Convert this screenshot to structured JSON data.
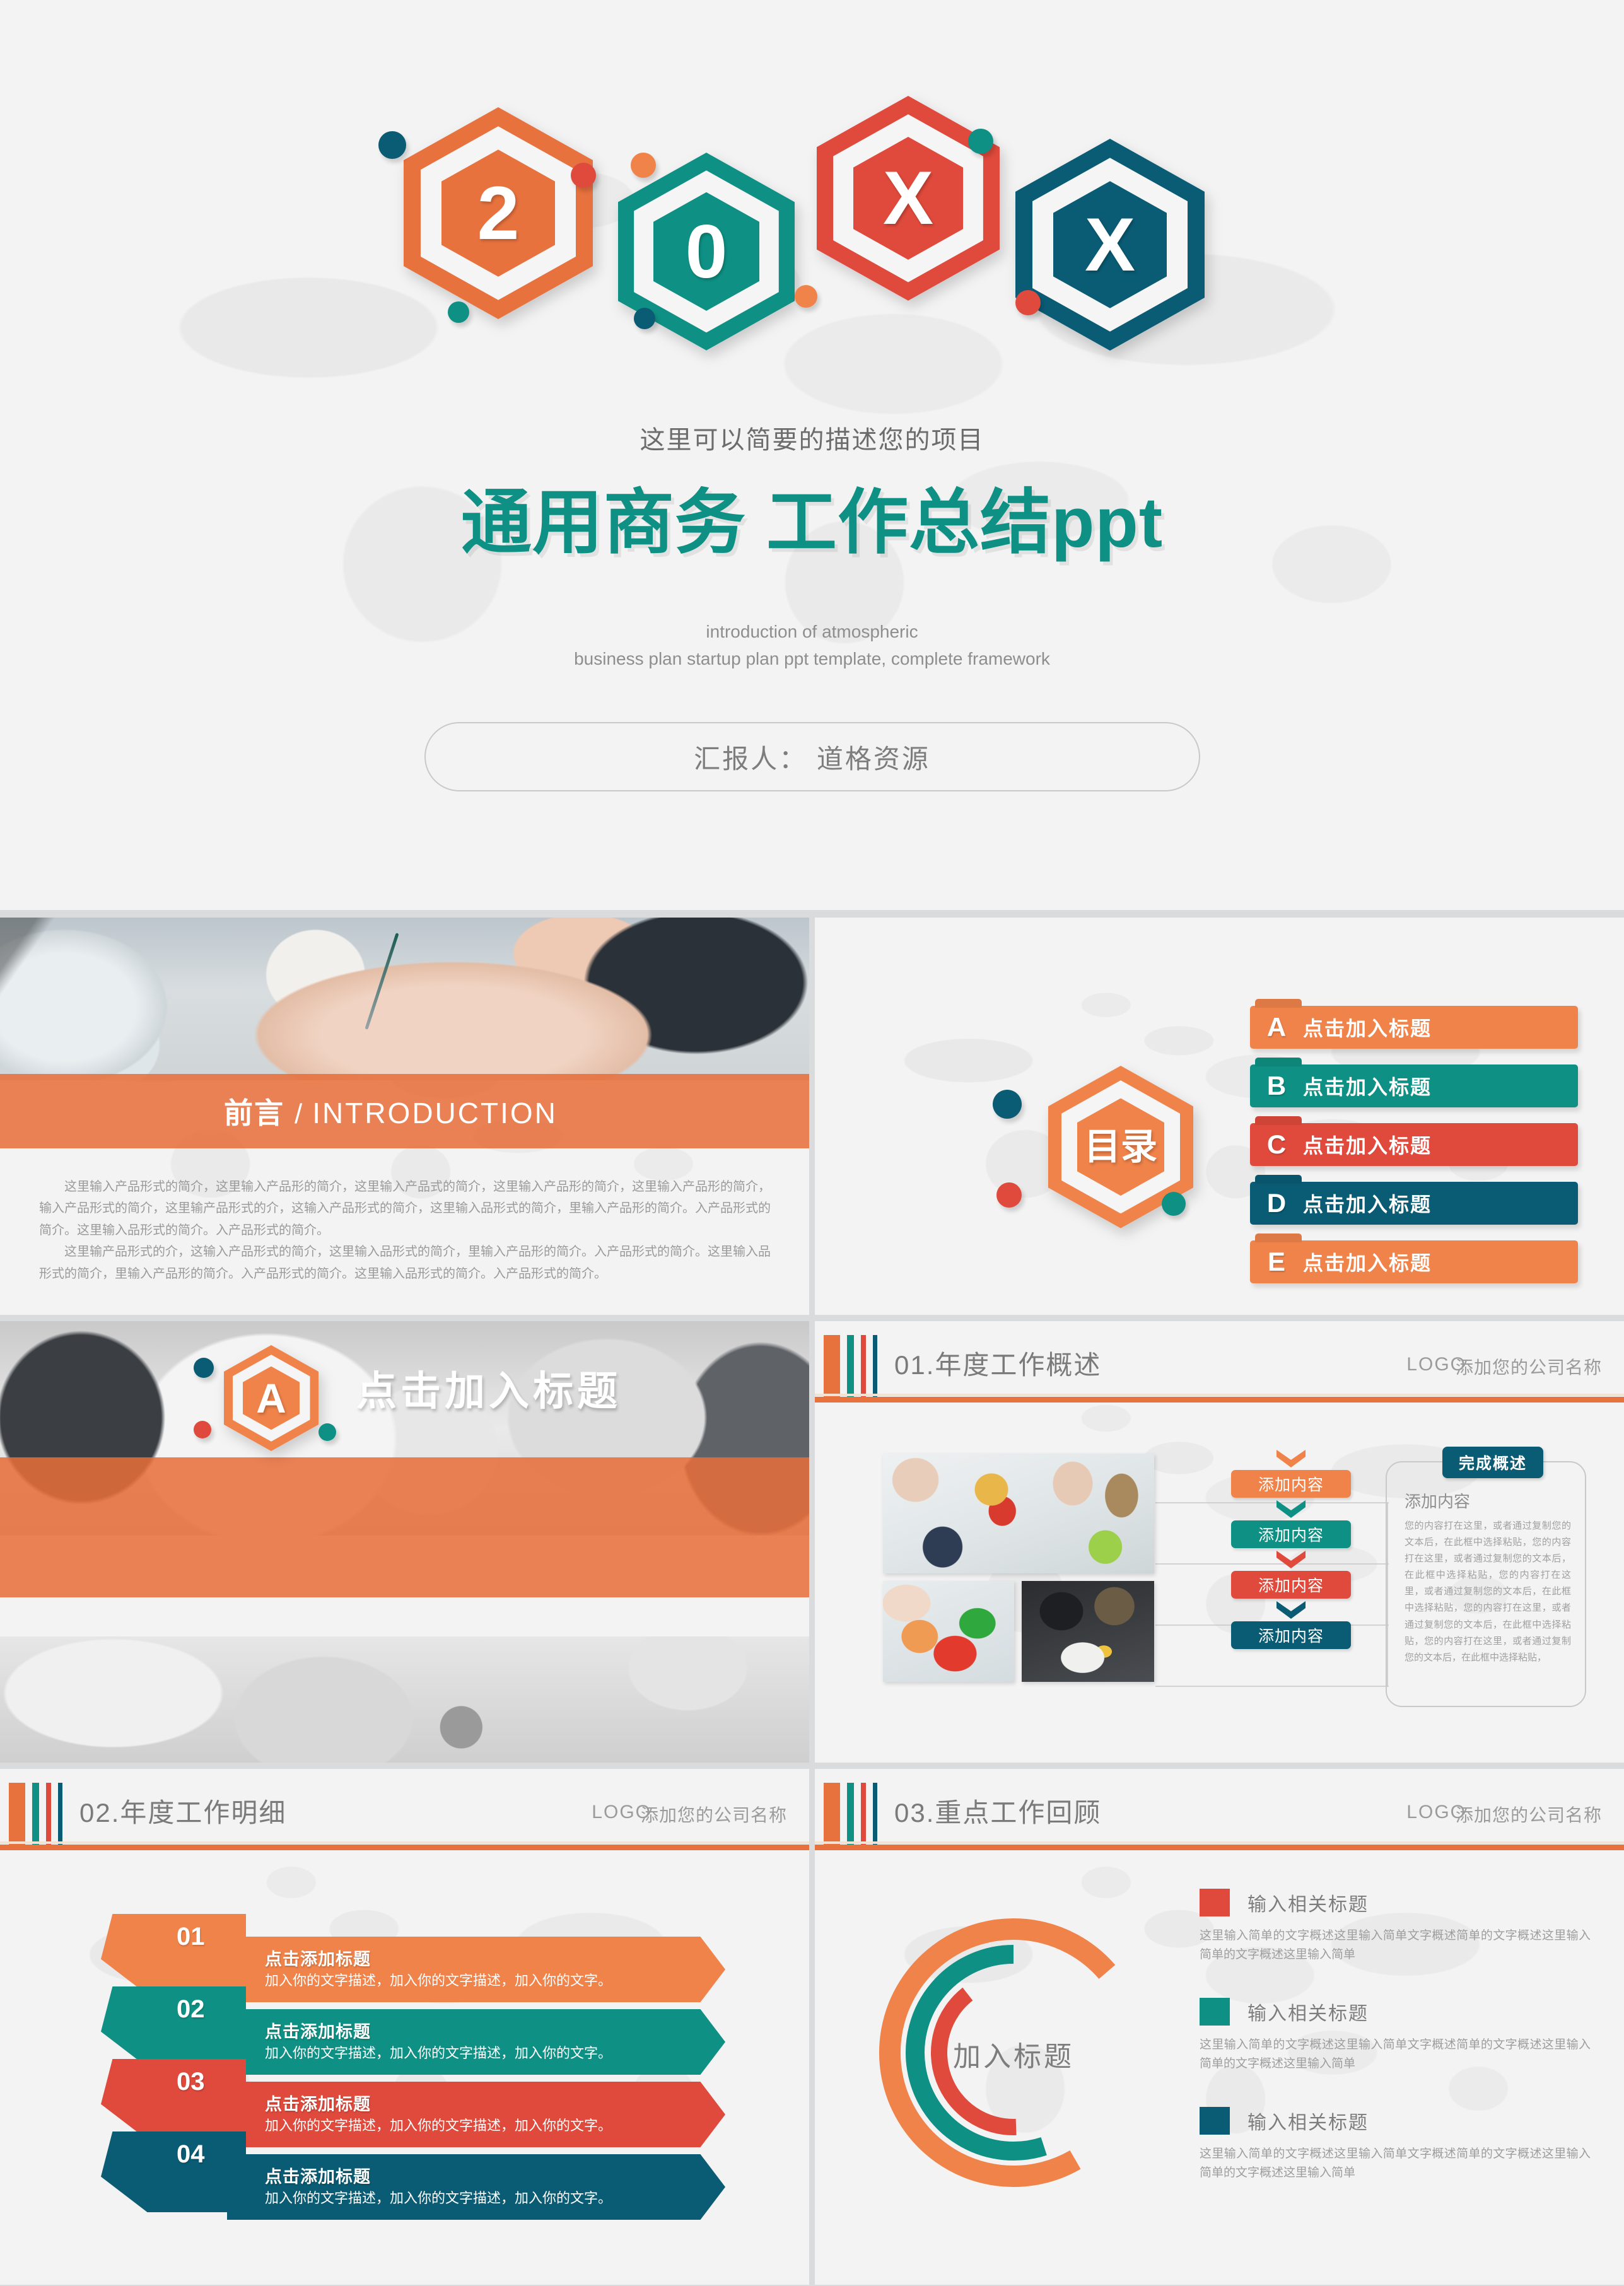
{
  "colors": {
    "orange": "#e8723e",
    "orange_light": "#f0834a",
    "teal": "#0e9184",
    "red": "#e04a3c",
    "navy": "#0a5c74",
    "bg": "#f3f3f3",
    "text_grey": "#7d7d7d"
  },
  "cover": {
    "hexagons": [
      {
        "glyph": "2",
        "color": "#e8723e"
      },
      {
        "glyph": "0",
        "color": "#0e9184"
      },
      {
        "glyph": "X",
        "color": "#e04a3c"
      },
      {
        "glyph": "X",
        "color": "#0a5c74"
      }
    ],
    "subtitle": "这里可以简要的描述您的项目",
    "title": "通用商务 工作总结ppt",
    "en_line1": "introduction of atmospheric",
    "en_line2": "business plan startup plan ppt template, complete framework",
    "presenter": "汇报人： 道格资源"
  },
  "intro": {
    "band_cn": "前言",
    "band_slash": "/",
    "band_en": "INTRODUCTION",
    "paragraph1": "这里输入产品形式的简介，这里输入产品形的简介，这里输入产品式的简介，这里输入产品形的简介，这里输入产品形的简介，输入产品形式的简介，这里输产品形式的介，这输入产品形式的简介，这里输入品形式的简介，里输入产品形的简介。入产品形式的简介。这里输入品形式的简介。入产品形式的简介。",
    "paragraph2": "这里输产品形式的介，这输入产品形式的简介，这里输入品形式的简介，里输入产品形的简介。入产品形式的简介。这里输入品形式的简介，里输入产品形的简介。入产品形式的简介。这里输入品形式的简介。入产品形式的简介。"
  },
  "toc": {
    "hex_label": "目录",
    "items": [
      {
        "letter": "A",
        "label": "点击加入标题",
        "color": "#f0834a"
      },
      {
        "letter": "B",
        "label": "点击加入标题",
        "color": "#0e9184"
      },
      {
        "letter": "C",
        "label": "点击加入标题",
        "color": "#e04a3c"
      },
      {
        "letter": "D",
        "label": "点击加入标题",
        "color": "#0a5c74"
      },
      {
        "letter": "E",
        "label": "点击加入标题",
        "color": "#f0834a"
      }
    ]
  },
  "section": {
    "hex_letter": "A",
    "title": "点击加入标题"
  },
  "overview": {
    "header_title": "01.年度工作概述",
    "logo": "LOGO",
    "company": "添加您的公司名称",
    "flow": [
      {
        "label": "添加内容",
        "color": "#f0834a"
      },
      {
        "label": "添加内容",
        "color": "#0e9184"
      },
      {
        "label": "添加内容",
        "color": "#e04a3c"
      },
      {
        "label": "添加内容",
        "color": "#0a5c74"
      }
    ],
    "card_tab": "完成概述",
    "card_heading": "添加内容",
    "card_body": "您的内容打在这里，或者通过复制您的文本后，在此框中选择粘贴，您的内容打在这里，或者通过复制您的文本后，在此框中选择粘贴，您的内容打在这里，或者通过复制您的文本后，在此框中选择粘贴，您的内容打在这里，或者通过复制您的文本后，在此框中选择粘贴，您的内容打在这里，或者通过复制您的文本后，在此框中选择粘贴，"
  },
  "detail": {
    "header_title": "02.年度工作明细",
    "logo": "LOGO",
    "company": "添加您的公司名称",
    "rows": [
      {
        "num": "01",
        "title": "点击添加标题",
        "desc": "加入你的文字描述，加入你的文字描述，加入你的文字。",
        "color": "#f0834a"
      },
      {
        "num": "02",
        "title": "点击添加标题",
        "desc": "加入你的文字描述，加入你的文字描述，加入你的文字。",
        "color": "#0e9184"
      },
      {
        "num": "03",
        "title": "点击添加标题",
        "desc": "加入你的文字描述，加入你的文字描述，加入你的文字。",
        "color": "#e04a3c"
      },
      {
        "num": "04",
        "title": "点击添加标题",
        "desc": "加入你的文字描述，加入你的文字描述，加入你的文字。",
        "color": "#0a5c74"
      }
    ]
  },
  "review": {
    "header_title": "03.重点工作回顾",
    "logo": "LOGO",
    "company": "添加您的公司名称",
    "donut_label": "加入标题",
    "legend": [
      {
        "title": "输入相关标题",
        "desc": "这里输入简单的文字概述这里输入简单文字概述简单的文字概述这里输入简单的文字概述这里输入简单",
        "color": "#e04a3c"
      },
      {
        "title": "输入相关标题",
        "desc": "这里输入简单的文字概述这里输入简单文字概述简单的文字概述这里输入简单的文字概述这里输入简单",
        "color": "#0e9184"
      },
      {
        "title": "输入相关标题",
        "desc": "这里输入简单的文字概述这里输入简单文字概述简单的文字概述这里输入简单的文字概述这里输入简单",
        "color": "#0a5c74"
      }
    ]
  },
  "chart_data": {
    "type": "pie",
    "title": "加入标题",
    "categories": [
      "输入相关标题",
      "输入相关标题",
      "输入相关标题"
    ],
    "values": [
      72,
      55,
      40
    ],
    "colors": [
      "#f0834a",
      "#0e9184",
      "#e04a3c"
    ],
    "legend": "right",
    "note": "three concentric open arcs (donut rings) with sweeps of roughly 260, 200 and 145 degrees"
  }
}
